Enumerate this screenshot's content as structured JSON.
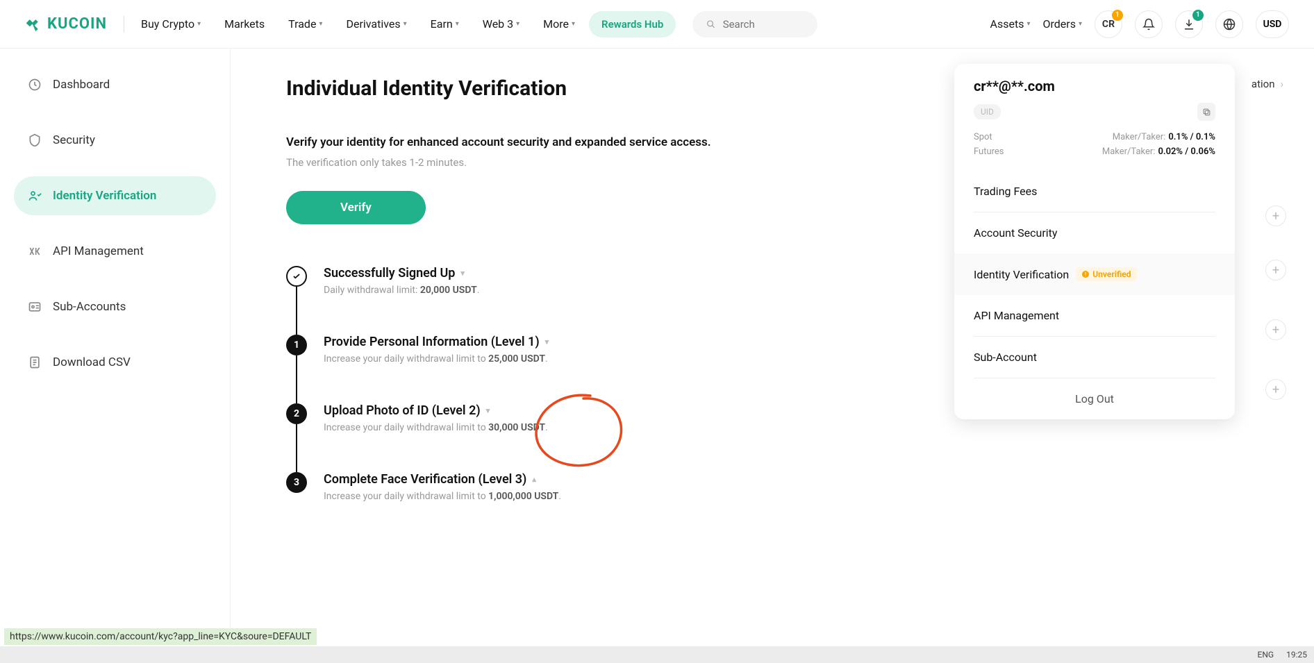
{
  "logo": "KUCOIN",
  "nav": {
    "buy_crypto": "Buy Crypto",
    "markets": "Markets",
    "trade": "Trade",
    "derivatives": "Derivatives",
    "earn": "Earn",
    "web3": "Web 3",
    "more": "More",
    "rewards_hub": "Rewards Hub",
    "search_placeholder": "Search",
    "assets": "Assets",
    "orders": "Orders",
    "avatar": "CR",
    "currency": "USD",
    "notif_badge": "1",
    "download_badge": "1"
  },
  "sidebar": {
    "dashboard": "Dashboard",
    "security": "Security",
    "identity": "Identity Verification",
    "api": "API Management",
    "subaccounts": "Sub-Accounts",
    "download_csv": "Download CSV"
  },
  "breadcrumb_tail": "ation",
  "page": {
    "title": "Individual Identity Verification",
    "sub1": "Verify your identity for enhanced account security and expanded service access.",
    "sub2": "The verification only takes 1-2 minutes.",
    "verify_btn": "Verify"
  },
  "steps": [
    {
      "title": "Successfully Signed Up",
      "desc_pre": "Daily withdrawal limit: ",
      "desc_b": "20,000 USDT",
      "desc_post": "."
    },
    {
      "title": "Provide Personal Information (Level 1)",
      "desc_pre": "Increase your daily withdrawal limit to ",
      "desc_b": "25,000 USDT",
      "desc_post": "."
    },
    {
      "title": "Upload Photo of ID (Level 2)",
      "desc_pre": "Increase your daily withdrawal limit to ",
      "desc_b": "30,000 USDT",
      "desc_post": "."
    },
    {
      "title": "Complete Face Verification (Level 3)",
      "desc_pre": "Increase your daily withdrawal limit to ",
      "desc_b": "1,000,000 USDT",
      "desc_post": "."
    }
  ],
  "panel": {
    "email": "cr**@**.com",
    "uic": "UID",
    "spot_label": "Spot",
    "spot_mt": "Maker/Taker:",
    "spot_val": "0.1% / 0.1%",
    "fut_label": "Futures",
    "fut_mt": "Maker/Taker:",
    "fut_val": "0.02% / 0.06%",
    "trading_fees": "Trading Fees",
    "acct_security": "Account Security",
    "identity": "Identity Verification",
    "unverified": "Unverified",
    "api_mgmt": "API Management",
    "subacct": "Sub-Account",
    "logout": "Log Out"
  },
  "url_tip": "https://www.kucoin.com/account/kyc?app_line=KYC&soure=DEFAULT",
  "taskbar": {
    "lang": "ENG",
    "time": "19:25"
  }
}
